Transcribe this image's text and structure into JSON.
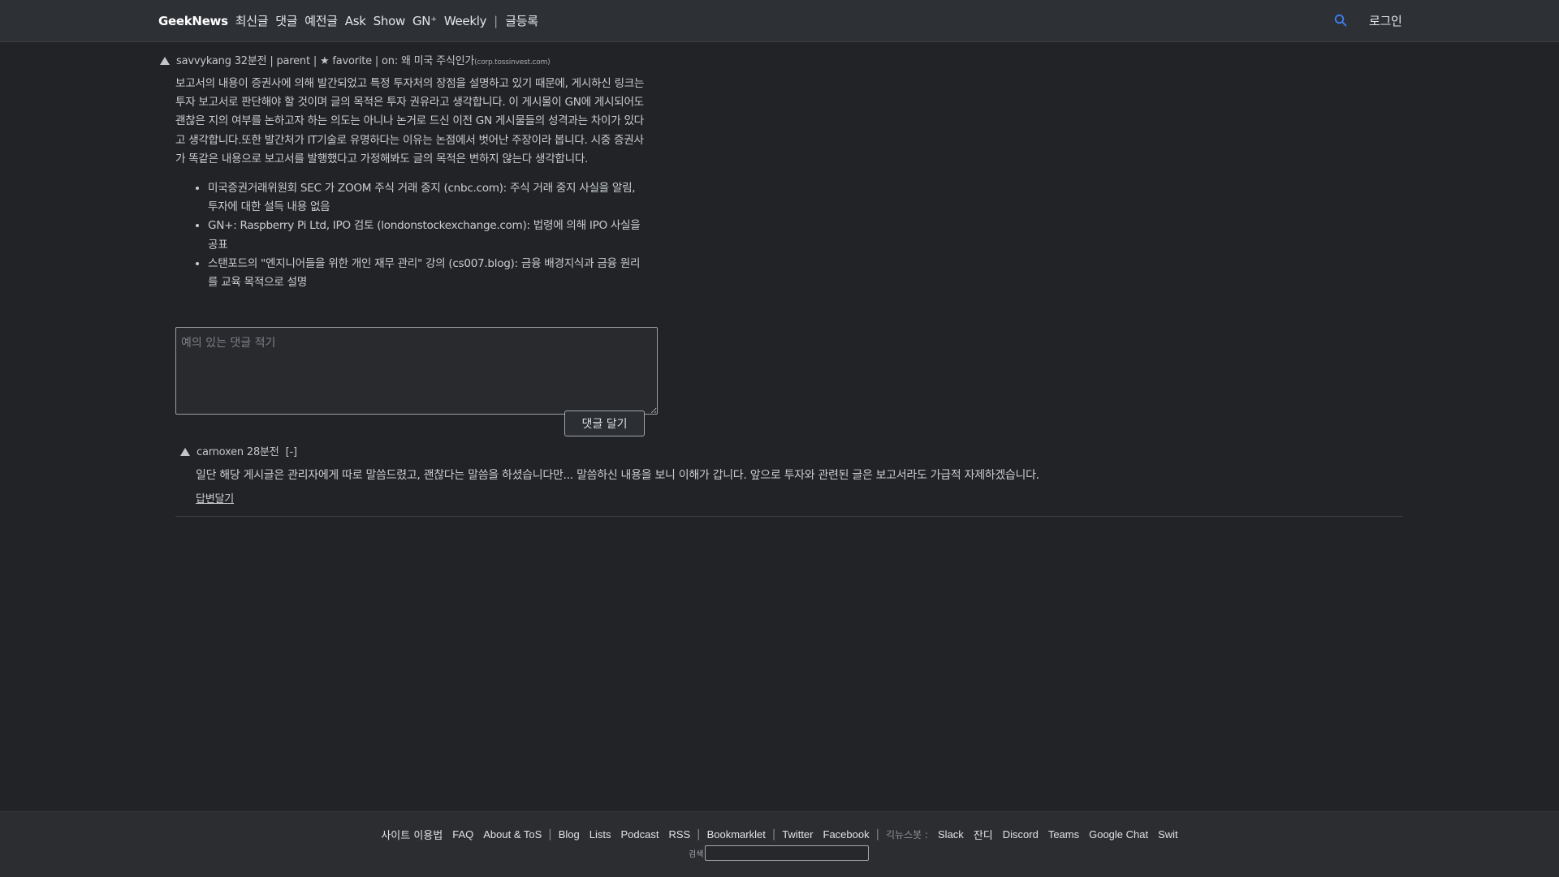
{
  "nav": {
    "brand": "GeekNews",
    "items": [
      "최신글",
      "댓글",
      "예전글",
      "Ask",
      "Show",
      "GN⁺",
      "Weekly"
    ],
    "separator": "|",
    "submit": "글등록",
    "login": "로그인",
    "search_icon": "search-icon",
    "accent": "#3b82f6"
  },
  "comment": {
    "author": "savvykang",
    "time": "32분전",
    "sep": "|",
    "parent": "parent",
    "favorite": "★ favorite",
    "on_label": "on:",
    "story": "왜 미국 주식인가",
    "source": "(corp.tossinvest.com)",
    "paragraph": "보고서의 내용이 증권사에 의해 발간되었고 특정 투자처의 장점을 설명하고 있기 때문에, 게시하신 링크는 투자 보고서로 판단해야 할 것이며 글의 목적은 투자 권유라고 생각합니다. 이 게시물이 GN에 게시되어도 괜찮은 지의 여부를 논하고자 하는 의도는 아니나 논거로 드신 이전 GN 게시물들의 성격과는 차이가 있다고 생각합니다.또한 발간처가 IT기술로 유명하다는 이유는 논점에서 벗어난 주장이라 봅니다. 시중 증권사가 똑같은 내용으로 보고서를 발행했다고 가정해봐도 글의 목적은 변하지 않는다 생각합니다.",
    "bullets": [
      "미국증권거래위원회 SEC 가 ZOOM 주식 거래 중지 (cnbc.com): 주식 거래 중지 사실을 알림, 투자에 대한 설득 내용 없음",
      "GN+: Raspberry Pi Ltd, IPO 검토 (londonstockexchange.com): 법령에 의해 IPO 사실을 공표",
      "스탠포드의 \"엔지니어들을 위한 개인 재무 관리\" 강의 (cs007.blog): 금융 배경지식과 금융 원리를 교육 목적으로 설명"
    ]
  },
  "reply_form": {
    "placeholder": "예의 있는 댓글 적기",
    "submit_label": "댓글 달기"
  },
  "child": {
    "author": "carnoxen",
    "time": "28분전",
    "toggle": "[-]",
    "text": "일단 해당 게시글은 관리자에게 따로 말씀드렸고, 괜찮다는 말씀을 하셨습니다만... 말씀하신 내용을 보니 이해가 갑니다. 앞으로 투자와 관련된 글은 보고서라도 가급적 자제하겠습니다.",
    "reply_label": "답변달기"
  },
  "footer": {
    "links_a": [
      "사이트 이용법",
      "FAQ",
      "About & ToS"
    ],
    "links_b": [
      "Blog",
      "Lists",
      "Podcast",
      "RSS"
    ],
    "links_c": [
      "Bookmarklet"
    ],
    "links_d": [
      "Twitter",
      "Facebook"
    ],
    "bot_label": "긱뉴스봇 :",
    "bots": [
      "Slack",
      "잔디",
      "Discord",
      "Teams",
      "Google Chat",
      "Swit"
    ],
    "sep": "|",
    "search_label": "검색"
  }
}
